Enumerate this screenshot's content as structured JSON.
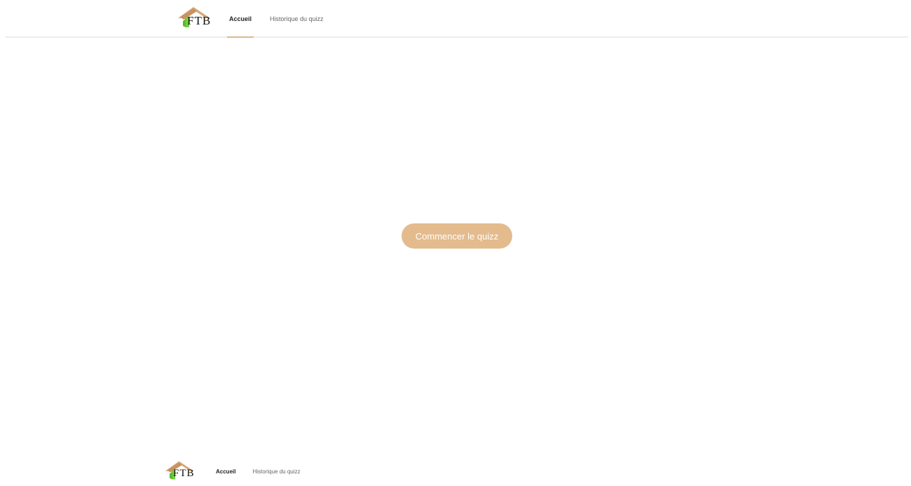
{
  "header": {
    "logo_text": "FTB",
    "nav": [
      {
        "label": "Accueil",
        "active": true
      },
      {
        "label": "Historique du quizz",
        "active": false
      }
    ]
  },
  "main": {
    "start_button_label": "Commencer le quizz"
  },
  "footer": {
    "logo_text": "FTB",
    "nav": [
      {
        "label": "Accueil",
        "active": true
      },
      {
        "label": "Historique du quizz",
        "active": false
      }
    ]
  },
  "colors": {
    "accent": "#e3bb8d",
    "logo_roof": "#d9a878",
    "logo_green": "#6fd13a",
    "divider": "#ececec"
  },
  "icons": {
    "logo": "house-roof-logo-icon"
  }
}
